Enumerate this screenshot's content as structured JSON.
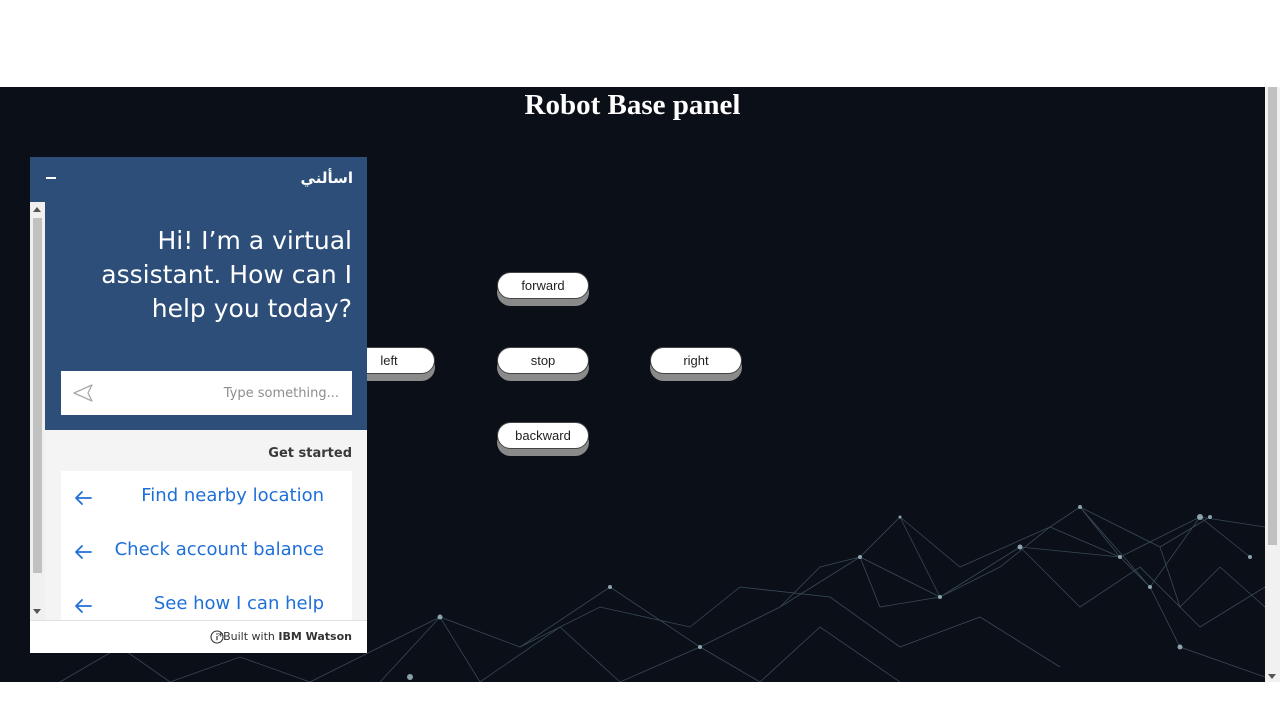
{
  "page": {
    "title": "Robot Base panel"
  },
  "controls": {
    "forward": "forward",
    "left": "left",
    "stop": "stop",
    "right": "right",
    "backward": "backward"
  },
  "chat": {
    "header_title": "اسألني",
    "greeting_lines": [
      "Hi! I’m a virtual",
      "assistant. How can I",
      "?help you today"
    ],
    "input_placeholder": "...Type something",
    "input_value": "",
    "get_started_label": "Get started",
    "options": [
      {
        "label": "Find nearby location"
      },
      {
        "label": "Check account balance"
      },
      {
        "label": "See how I can help"
      }
    ],
    "footer_prefix": "*Built with ",
    "footer_brand": "IBM Watson"
  },
  "colors": {
    "background": "#0a0f18",
    "chat_header": "#2c4e79",
    "link": "#1f6fd8"
  },
  "icons": {
    "minimize": "minimize-icon",
    "send": "send-icon",
    "option_arrow": "arrow-left-icon",
    "info": "info-icon"
  }
}
